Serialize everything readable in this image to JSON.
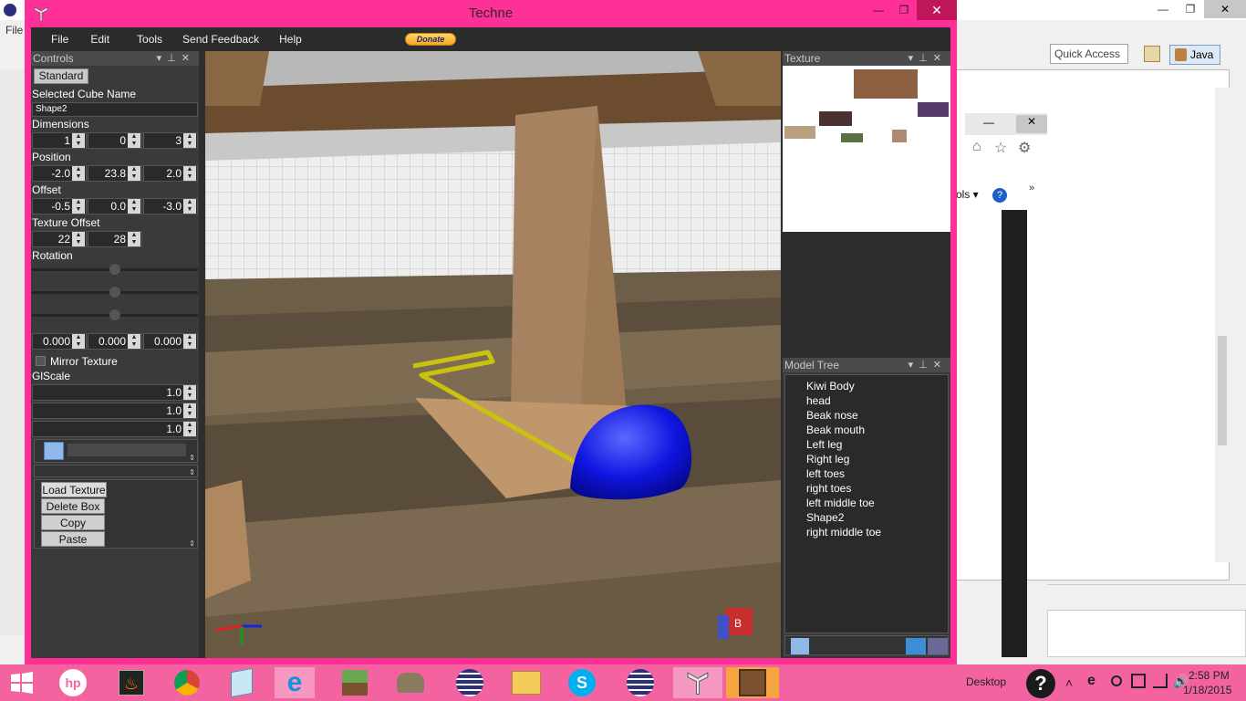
{
  "eclipse": {
    "menu_file": "File",
    "quick_access": "Quick Access",
    "perspective": "Java",
    "tools_label": "ols"
  },
  "techne": {
    "title": "Techne",
    "menu": [
      "File",
      "Edit",
      "Tools",
      "Send Feedback",
      "Help"
    ],
    "donate": "Donate"
  },
  "controls": {
    "panel_title": "Controls",
    "mode_button": "Standard",
    "selected_cube_label": "Selected Cube Name",
    "selected_cube_name": "Shape2",
    "dimensions_label": "Dimensions",
    "dimensions": [
      "1",
      "0",
      "3"
    ],
    "position_label": "Position",
    "position": [
      "-2.0",
      "23.8",
      "2.0"
    ],
    "offset_label": "Offset",
    "offset": [
      "-0.5",
      "0.0",
      "-3.0"
    ],
    "texture_offset_label": "Texture Offset",
    "texture_offset": [
      "22",
      "28"
    ],
    "rotation_label": "Rotation",
    "rotation": [
      "0.000",
      "0.000",
      "0.000"
    ],
    "mirror_texture": "Mirror Texture",
    "glscale_label": "GlScale",
    "glscale": [
      "1.0",
      "1.0",
      "1.0"
    ],
    "buttons": {
      "load_texture": "Load Texture",
      "delete_box": "Delete Box",
      "copy": "Copy",
      "paste": "Paste"
    }
  },
  "texture_panel": {
    "title": "Texture"
  },
  "model_tree": {
    "title": "Model Tree",
    "items": [
      "Kiwi Body",
      "head",
      "Beak nose",
      "Beak mouth",
      "Left leg",
      "Right leg",
      "left toes",
      "right toes",
      "left middle toe",
      "Shape2",
      "right middle toe"
    ]
  },
  "taskbar": {
    "desktop_label": "Desktop",
    "time": "2:58 PM",
    "date": "1/18/2015"
  },
  "colors": {
    "techne_border": "#ff2f98",
    "taskbar": "#f2639f",
    "panel_bg": "#3a3a3a"
  }
}
